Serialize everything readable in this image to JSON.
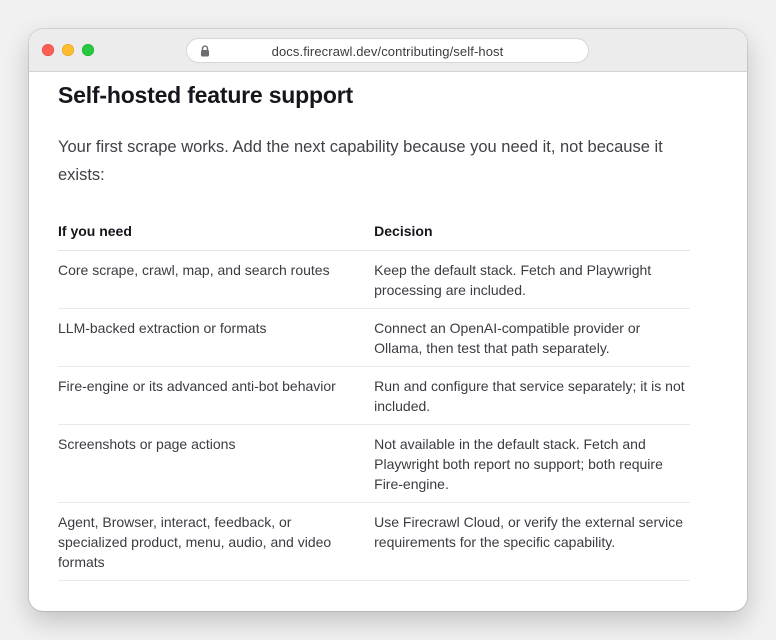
{
  "browser": {
    "url": "docs.firecrawl.dev/contributing/self-host"
  },
  "page": {
    "title": "Self-hosted feature support",
    "intro": "Your first scrape works. Add the next capability because you need it, not because it exists:"
  },
  "table": {
    "headers": [
      "If you need",
      "Decision"
    ],
    "rows": [
      {
        "need": "Core scrape, crawl, map, and search routes",
        "decision": "Keep the default stack. Fetch and Playwright processing are included."
      },
      {
        "need": "LLM-backed extraction or formats",
        "decision": "Connect an OpenAI-compatible provider or Ollama, then test that path separately."
      },
      {
        "need": "Fire-engine or its advanced anti-bot behavior",
        "decision": "Run and configure that service separately; it is not included."
      },
      {
        "need": "Screenshots or page actions",
        "decision": "Not available in the default stack. Fetch and Playwright both report no support; both require Fire-engine."
      },
      {
        "need": "Agent, Browser, interact, feedback, or specialized product, menu, audio, and video formats",
        "decision": "Use Firecrawl Cloud, or verify the external service requirements for the specific capability."
      }
    ]
  },
  "colors": {
    "close": "#fe5f57",
    "minimize": "#febc2e",
    "zoom": "#28c840"
  },
  "icons": {
    "url_lock": "lock-icon"
  }
}
